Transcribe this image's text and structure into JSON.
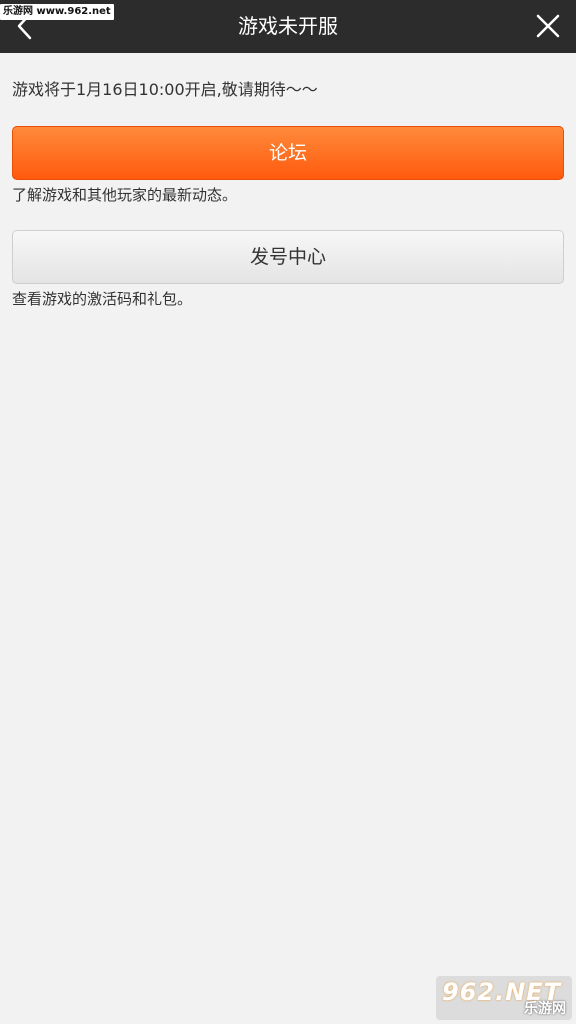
{
  "header": {
    "title": "游戏未开服",
    "back_icon": "chevron-left-icon",
    "close_icon": "close-icon",
    "background": "#2c2c2c"
  },
  "watermark": {
    "top_text": "乐游网 www.962.net",
    "bottom_big": "962.NET",
    "bottom_small": "乐游网"
  },
  "main": {
    "notice": "游戏将于1月16日10:00开启,敬请期待～～",
    "forum_button": "论坛",
    "forum_desc": "了解游戏和其他玩家的最新动态。",
    "code_center_button": "发号中心",
    "code_center_desc": "查看游戏的激活码和礼包。"
  },
  "colors": {
    "accent": "#ff6a1a",
    "page_bg": "#f2f2f2"
  }
}
